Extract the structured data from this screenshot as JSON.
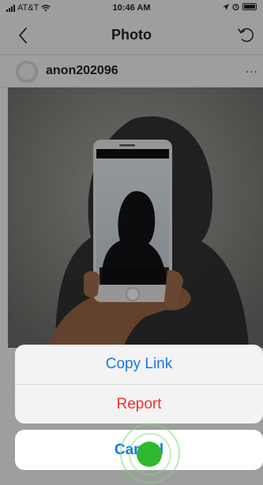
{
  "status_bar": {
    "carrier": "AT&T",
    "time": "10:46 AM"
  },
  "nav": {
    "title": "Photo"
  },
  "post": {
    "username": "anon202096",
    "more": "..."
  },
  "action_sheet": {
    "copy_link": "Copy Link",
    "report": "Report",
    "cancel": "Cancel"
  },
  "colors": {
    "action_blue": "#1677e8",
    "destructive_red": "#f03030",
    "touch_green": "#2eb82e"
  }
}
